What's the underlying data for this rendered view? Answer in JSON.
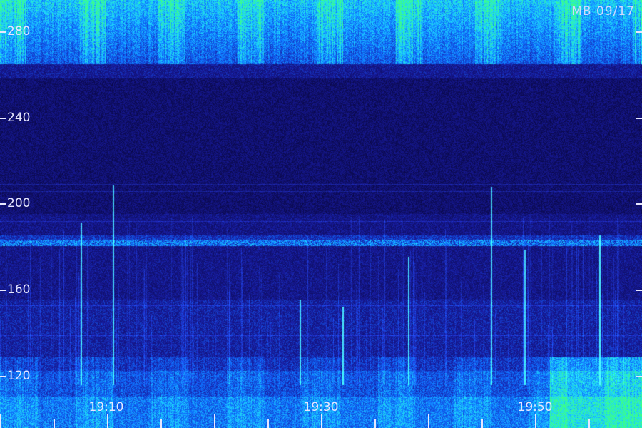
{
  "station_stamp": "MB 09/17",
  "y_axis": {
    "ticks": [
      "280",
      "240",
      "200",
      "160",
      "120"
    ],
    "range": [
      100,
      290
    ]
  },
  "x_axis": {
    "ticks": [
      "19:10",
      "19:30",
      "19:50"
    ]
  },
  "colors": {
    "background": "#0d0a5a",
    "low": "#1a1590",
    "mid": "#1d5cff",
    "high": "#20d4ff",
    "peak": "#30ff90",
    "label": "#e6e6ff"
  }
}
